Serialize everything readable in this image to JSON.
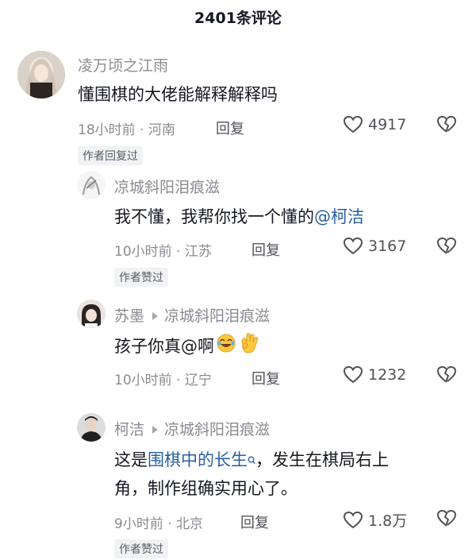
{
  "header": {
    "title": "2401条评论"
  },
  "comments": [
    {
      "user": "凌万顷之江雨",
      "text": "懂围棋的大佬能解释解释吗",
      "time_location": "18小时前 · 河南",
      "reply_label": "回复",
      "likes": "4917",
      "badge": "作者回复过"
    },
    {
      "user": "凉城斜阳泪痕滋",
      "text_prefix": "我不懂，我帮你找一个懂的",
      "mention": "@柯洁",
      "time_location": "10小时前 · 江苏",
      "reply_label": "回复",
      "likes": "3167",
      "badge": "作者赞过"
    },
    {
      "user": "苏墨",
      "reply_to": "凉城斜阳泪痕滋",
      "text": "孩子你真@啊",
      "time_location": "10小时前 · 辽宁",
      "reply_label": "回复",
      "likes": "1232"
    },
    {
      "user": "柯洁",
      "reply_to": "凉城斜阳泪痕滋",
      "text_line1_prefix": "这是",
      "link": "围棋中的长生",
      "text_line1_suffix": "，发生在棋局右上",
      "text_line2": "角，制作组确实用心了。",
      "time_location": "9小时前 · 北京",
      "reply_label": "回复",
      "likes": "1.8万",
      "badge": "作者赞过"
    }
  ],
  "icon_names": [
    "heart-icon",
    "broken-heart-icon",
    "search-icon",
    "laughing-emoji-icon",
    "ok-hand-emoji-icon",
    "reply-arrow-icon"
  ],
  "colors": {
    "text": "#161823",
    "meta": "#8a8b91",
    "link": "#2a5f9f",
    "badge_bg": "#f1f2f4"
  }
}
